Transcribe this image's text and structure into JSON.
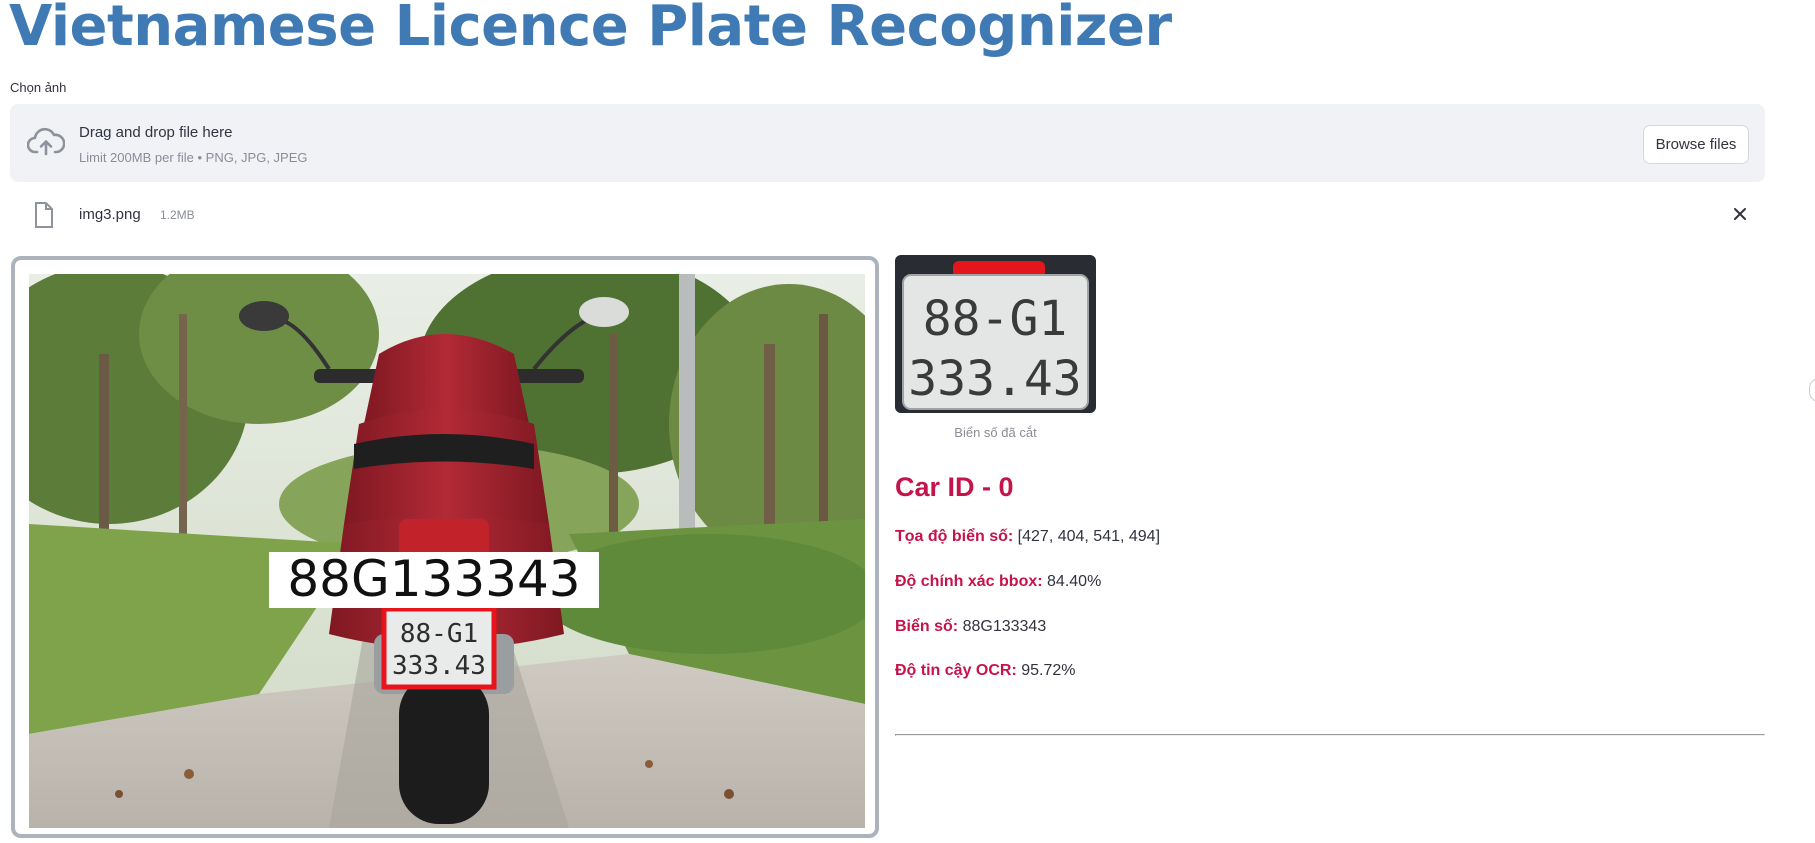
{
  "page": {
    "title": "Vietnamese Licence Plate Recognizer"
  },
  "uploader": {
    "label": "Chọn ảnh",
    "drop_text": "Drag and drop file here",
    "limit_text": "Limit 200MB per file • PNG, JPG, JPEG",
    "browse_label": "Browse files"
  },
  "file": {
    "name": "img3.png",
    "size": "1.2MB"
  },
  "result": {
    "overlay_text": "88G133343",
    "plate_line1": "88-G1",
    "plate_line2": "333.43",
    "crop_caption": "Biển số đã cắt",
    "car_heading": "Car ID - 0",
    "coords_label": "Tọa độ biển số:",
    "coords_value": "[427, 404, 541, 494]",
    "bbox_conf_label": "Độ chính xác bbox:",
    "bbox_conf_value": "84.40%",
    "plate_label": "Biển số:",
    "plate_value": "88G133343",
    "ocr_conf_label": "Độ tin cậy OCR:",
    "ocr_conf_value": "95.72%"
  },
  "colors": {
    "title": "#3f7ab5",
    "accent": "#c5144b",
    "dropzone_bg": "#f0f2f6",
    "bbox": "#e8141c"
  },
  "icons": {
    "upload": "cloud-upload-icon",
    "file": "file-icon",
    "remove": "close-icon"
  }
}
